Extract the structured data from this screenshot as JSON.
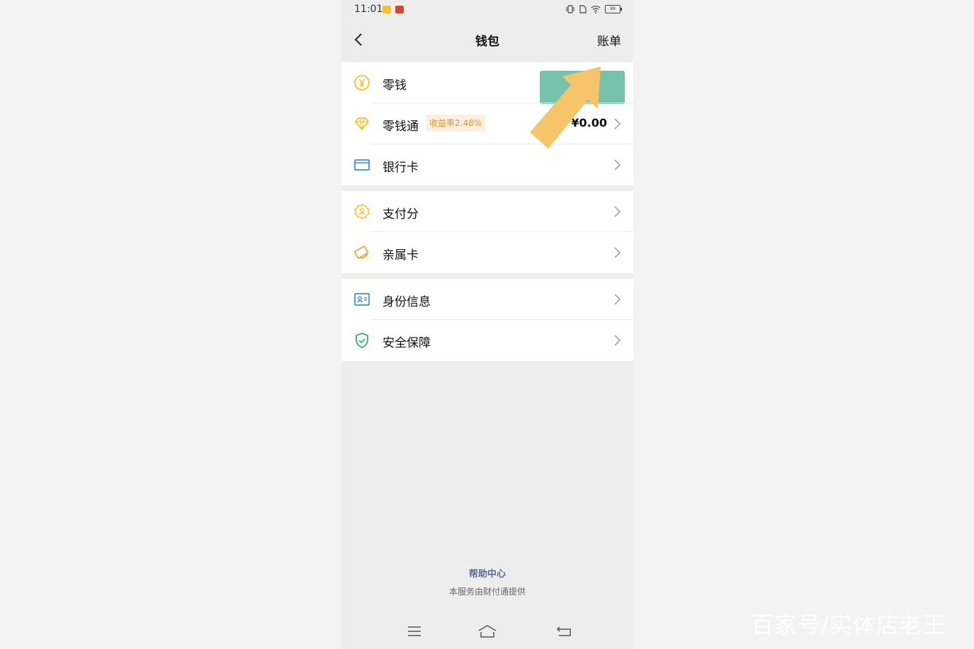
{
  "status_bar": {
    "time": "11:01",
    "battery": "99"
  },
  "header": {
    "title": "钱包",
    "right_label": "账单"
  },
  "group1": {
    "items": [
      {
        "label": "零钱",
        "icon": "yuan-coin-icon"
      },
      {
        "label": "零钱通",
        "icon": "diamond-icon",
        "badge": "收益率2.48%",
        "amount": "¥0.00"
      },
      {
        "label": "银行卡",
        "icon": "bank-card-icon"
      }
    ]
  },
  "group2": {
    "items": [
      {
        "label": "支付分",
        "icon": "pay-score-icon"
      },
      {
        "label": "亲属卡",
        "icon": "family-card-icon"
      }
    ]
  },
  "group3": {
    "items": [
      {
        "label": "身份信息",
        "icon": "id-card-icon"
      },
      {
        "label": "安全保障",
        "icon": "shield-icon"
      }
    ]
  },
  "footer": {
    "help_label": "帮助中心",
    "note": "本服务由财付通提供"
  },
  "watermark": "百家号/实体店老王",
  "colors": {
    "accent_yellow": "#f2c230",
    "accent_blue": "#3d8fd1",
    "accent_green": "#2fb36b",
    "annotation_arrow": "#f6c56a",
    "annotation_block": "#76c2ad",
    "link_blue": "#5a6d96"
  }
}
